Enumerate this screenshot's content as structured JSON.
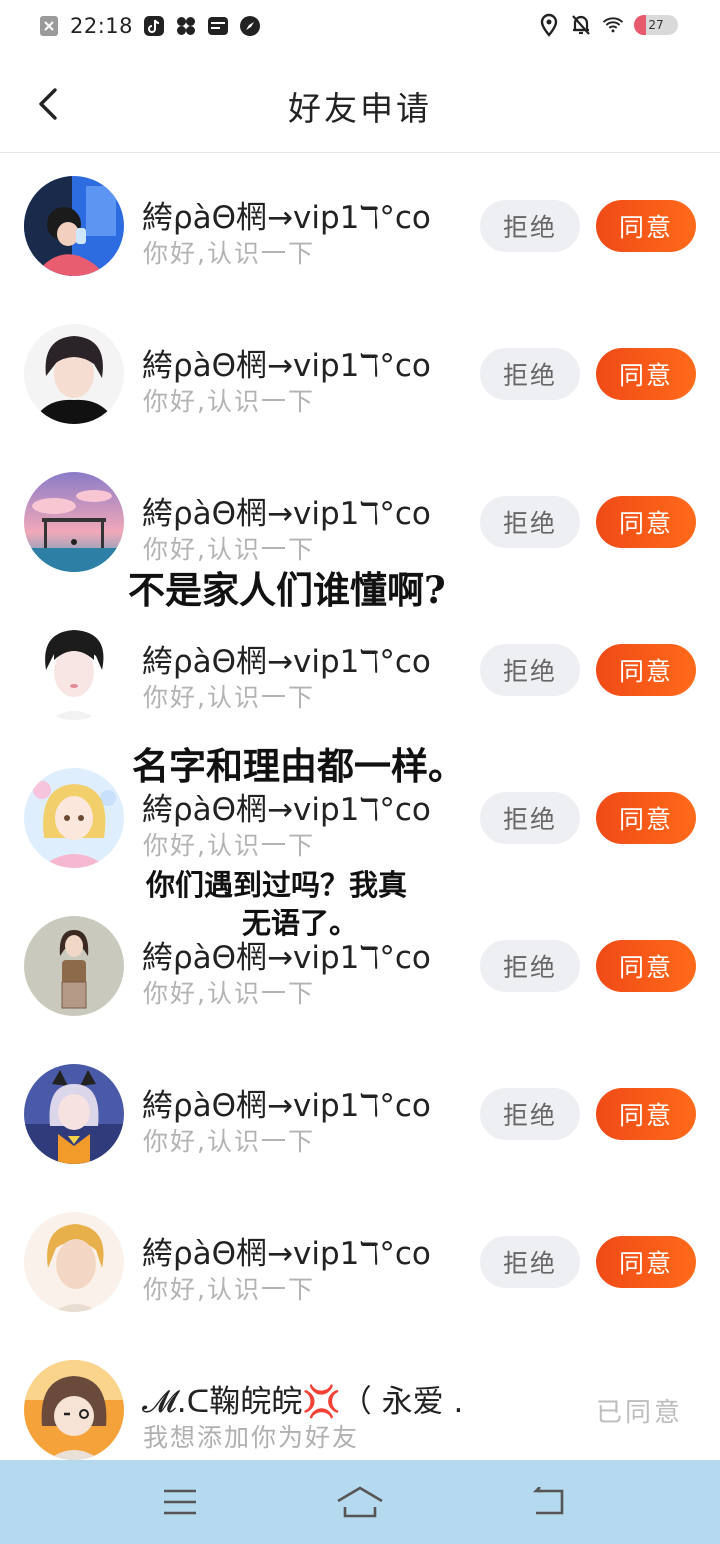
{
  "status_bar": {
    "time": "22:18",
    "battery": "27",
    "battery_level": 0.27,
    "left_icons": [
      "close-box-icon",
      "tiktok-icon",
      "pinwheel-icon",
      "wallet-icon",
      "compass-icon"
    ],
    "right_icons": [
      "location-icon",
      "mute-bell-icon",
      "wifi-icon",
      "battery-icon"
    ]
  },
  "header": {
    "title": "好友申请"
  },
  "requests": [
    {
      "name": "絝ρàΘ棢→vip1ℸ°co",
      "message": "你好,认识一下",
      "reject": "拒绝",
      "accept": "同意"
    },
    {
      "name": "絝ρàΘ棢→vip1ℸ°co",
      "message": "你好,认识一下",
      "reject": "拒绝",
      "accept": "同意"
    },
    {
      "name": "絝ρàΘ棢→vip1ℸ°co",
      "message": "你好,认识一下",
      "reject": "拒绝",
      "accept": "同意"
    },
    {
      "name": "絝ρàΘ棢→vip1ℸ°co",
      "message": "你好,认识一下",
      "reject": "拒绝",
      "accept": "同意"
    },
    {
      "name": "絝ρàΘ棢→vip1ℸ°co",
      "message": "你好,认识一下",
      "reject": "拒绝",
      "accept": "同意"
    },
    {
      "name": "絝ρàΘ棢→vip1ℸ°co",
      "message": "你好,认识一下",
      "reject": "拒绝",
      "accept": "同意"
    },
    {
      "name": "絝ρàΘ棢→vip1ℸ°co",
      "message": "你好,认识一下",
      "reject": "拒绝",
      "accept": "同意"
    },
    {
      "name": "絝ρàΘ棢→vip1ℸ°co",
      "message": "你好,认识一下",
      "reject": "拒绝",
      "accept": "同意"
    }
  ],
  "last_request": {
    "name": "𝓜.ᑕ鞠皖皖💢（ 永爱 ...",
    "message": "我想添加你为好友",
    "status": "已同意"
  },
  "captions": {
    "line1": "不是家人们谁懂啊?",
    "line2": "名字和理由都一样。",
    "line3": "你们遇到过吗？我真",
    "line4": "无语了。"
  },
  "nav_bar": {
    "icons": [
      "menu-icon",
      "home-icon",
      "back-arrow-icon"
    ]
  },
  "colors": {
    "accent": "#ff5a1a",
    "reject_bg": "#eeeff3",
    "nav_bg": "#b5d9ef"
  }
}
